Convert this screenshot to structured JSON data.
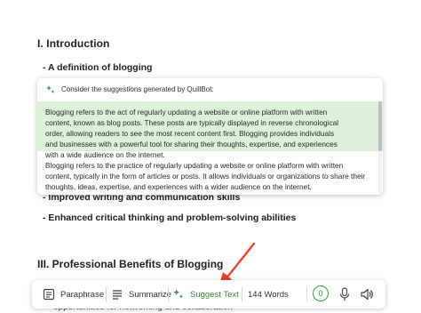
{
  "document": {
    "heading_1": "I. Introduction",
    "bullet_1": "- A definition of blogging",
    "bullet_2": "- Improved writing and communication skills",
    "bullet_3": "- Enhanced critical thinking and problem-solving abilities",
    "heading_2": "III. Professional Benefits of Blogging",
    "partial_line": "opportunities for networking and collaboration"
  },
  "popup": {
    "header": "Consider the suggestions generated by QuillBot:",
    "header_icon": "sparkle-icon",
    "suggestion_1": "Blogging refers to the act of regularly updating a website or online platform with written content, known as blog posts. These posts are typically displayed in reverse chronological order, allowing readers to see the most recent content first. Blogging provides individuals and businesses with a powerful tool for sharing their thoughts, expertise, and experiences with a wide audience on the internet.",
    "suggestion_2": "Blogging refers to the practice of regularly updating a website or online platform with written content, typically in the form of articles or posts. It allows individuals or organizations to share their thoughts, ideas, expertise, and experiences with a wider audience on the internet.",
    "highlight_color": "#ddf0da"
  },
  "toolbar": {
    "paraphrase_label": "Paraphrase",
    "summarize_label": "Summarize",
    "suggest_label": "Suggest Text",
    "word_count": "144 Words",
    "issues_count": "0",
    "accent_color": "#3d8b3d"
  },
  "annotation": {
    "arrow_color": "#e8412c"
  }
}
